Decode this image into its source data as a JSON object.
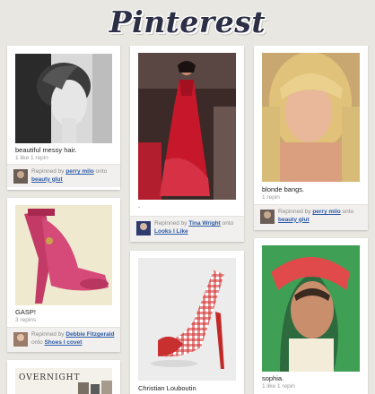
{
  "app": {
    "logo": "Pinterest"
  },
  "pins": [
    {
      "id": "messy-hair",
      "description": "beautiful messy hair.",
      "stats": "1 like  1 repin",
      "repinned_by_prefix": "Repinned by ",
      "user": "perry milo",
      "onto": " onto ",
      "board": "beauty glut"
    },
    {
      "id": "red-gown",
      "description": ".",
      "stats": "",
      "repinned_by_prefix": "Repinned by ",
      "user": "Tina Wright",
      "onto": " onto ",
      "board": "Looks I Like"
    },
    {
      "id": "blonde",
      "description": "blonde bangs.",
      "stats": "1 repin",
      "repinned_by_prefix": "Repinned by ",
      "user": "perry milo",
      "onto": " onto ",
      "board": "beauty glut"
    },
    {
      "id": "pink-heels",
      "description": "GASP!",
      "stats": "3 repins",
      "repinned_by_prefix": "Repinned by ",
      "user": "Debbie Fitzgerald",
      "onto": " onto ",
      "board": "Shoes I covet"
    },
    {
      "id": "louboutin",
      "description": "Christian Louboutin"
    },
    {
      "id": "sophia",
      "description": "sophia.",
      "stats": "1 like  1 repin"
    },
    {
      "id": "overnight",
      "image_text": "OVERNIGHT"
    }
  ]
}
